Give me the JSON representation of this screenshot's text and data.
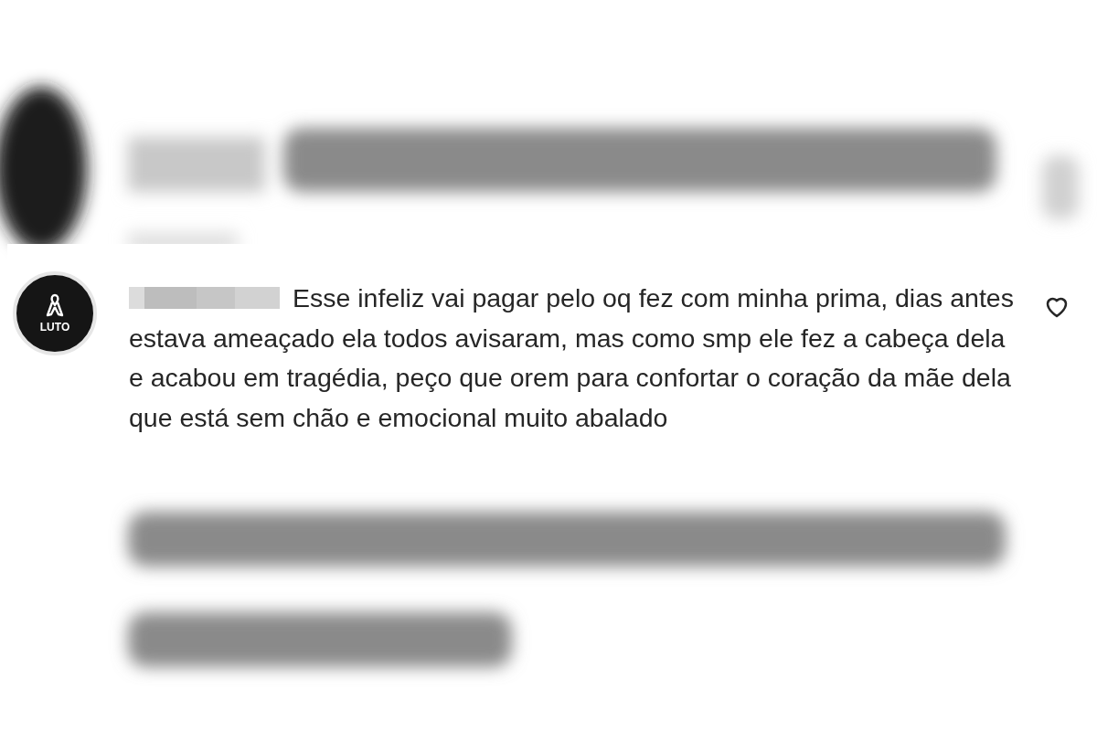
{
  "comment": {
    "avatar_label": "LUTO",
    "text": "Esse infeliz vai pagar pelo oq fez com minha prima, dias antes estava ameaçado ela todos avisaram, mas como smp ele fez a cabeça dela e acabou em tragédia, peço que orem para confortar o coração da mãe dela que está sem chão e emocional muito abalado",
    "liked": false
  }
}
